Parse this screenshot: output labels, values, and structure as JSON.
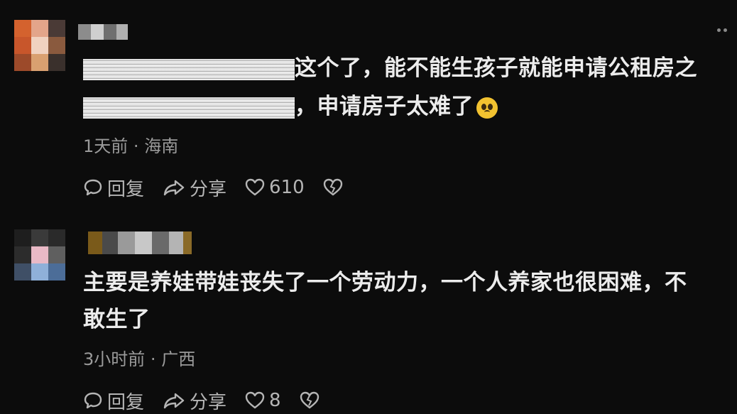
{
  "comments": [
    {
      "line1_text": "这个了，能不能生孩子就能申请公租房之",
      "line2_text": "，申请房子太难了",
      "time": "1天前",
      "separator": "·",
      "location": "海南",
      "reply_label": "回复",
      "share_label": "分享",
      "like_count": "610",
      "emoji_icon": "pleading-face-icon"
    },
    {
      "line1_text": "主要是养娃带娃丧失了一个劳动力，一个人养家也很困难，不",
      "line2_text": "敢生了",
      "time": "3小时前",
      "separator": "·",
      "location": "广西",
      "reply_label": "回复",
      "share_label": "分享",
      "like_count": "8"
    }
  ],
  "colors": {
    "background": "#0c0c0c",
    "text": "#ececec",
    "meta": "#9b9b9b",
    "action": "#b5b5b5"
  }
}
